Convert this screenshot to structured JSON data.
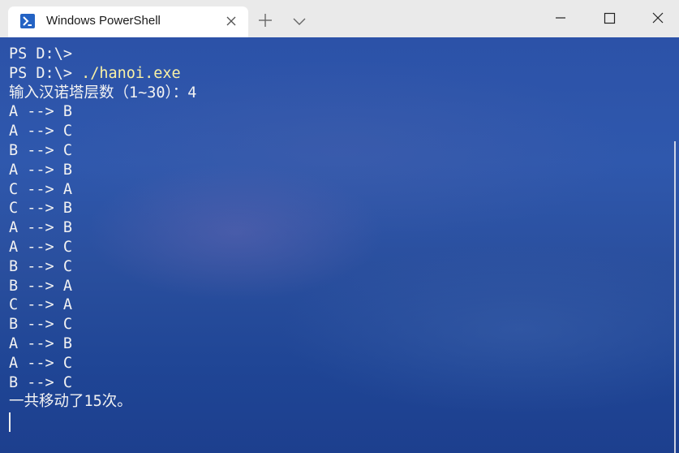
{
  "window": {
    "tab_title": "Windows PowerShell",
    "icons": {
      "tab_icon": "powershell-icon",
      "tab_close": "close-icon",
      "new_tab": "plus-icon",
      "dropdown": "chevron-down-icon",
      "minimize": "minimize-icon",
      "maximize": "maximize-icon",
      "close": "close-icon"
    }
  },
  "terminal": {
    "line_0_prompt": "PS D:\\>",
    "line_1_prompt": "PS D:\\> ",
    "line_1_command": "./hanoi.exe",
    "input_prompt": "输入汉诺塔层数（1~30）：4",
    "moves": [
      "A --> B",
      "A --> C",
      "B --> C",
      "A --> B",
      "C --> A",
      "C --> B",
      "A --> B",
      "A --> C",
      "B --> C",
      "B --> A",
      "C --> A",
      "B --> C",
      "A --> B",
      "A --> C",
      "B --> C"
    ],
    "summary": "一共移动了15次。"
  },
  "colors": {
    "titlebar_bg": "#eaeaea",
    "terminal_bg": "#2f56a8",
    "text": "#f2f2f2",
    "command_highlight": "#f9f1a5",
    "powershell_icon_bg": "#2463c4"
  }
}
